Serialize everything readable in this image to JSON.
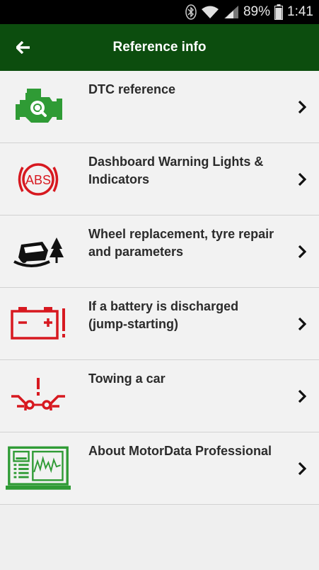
{
  "status_bar": {
    "battery_percent": "89%",
    "time": "1:41",
    "icons": [
      "bluetooth-icon",
      "wifi-icon",
      "signal-icon",
      "battery-icon"
    ]
  },
  "app_bar": {
    "title": "Reference info",
    "back_icon": "back-arrow-icon"
  },
  "colors": {
    "app_bar": "#0c4d0e",
    "green_icon": "#2f9b35",
    "red_icon": "#d71920",
    "background": "#f2f2f2"
  },
  "items": [
    {
      "label": "DTC reference",
      "icon": "engine-search-icon"
    },
    {
      "label": "Dashboard Warning Lights & Indicators",
      "icon": "abs-warning-icon"
    },
    {
      "label": "Wheel replacement, tyre repair and parameters",
      "icon": "car-ditch-icon"
    },
    {
      "label": "If a battery is discharged (jump-starting)",
      "icon": "battery-warning-icon"
    },
    {
      "label": "Towing a car",
      "icon": "towing-icon"
    },
    {
      "label": "About MotorData Professional",
      "icon": "laptop-diagnostics-icon"
    }
  ]
}
